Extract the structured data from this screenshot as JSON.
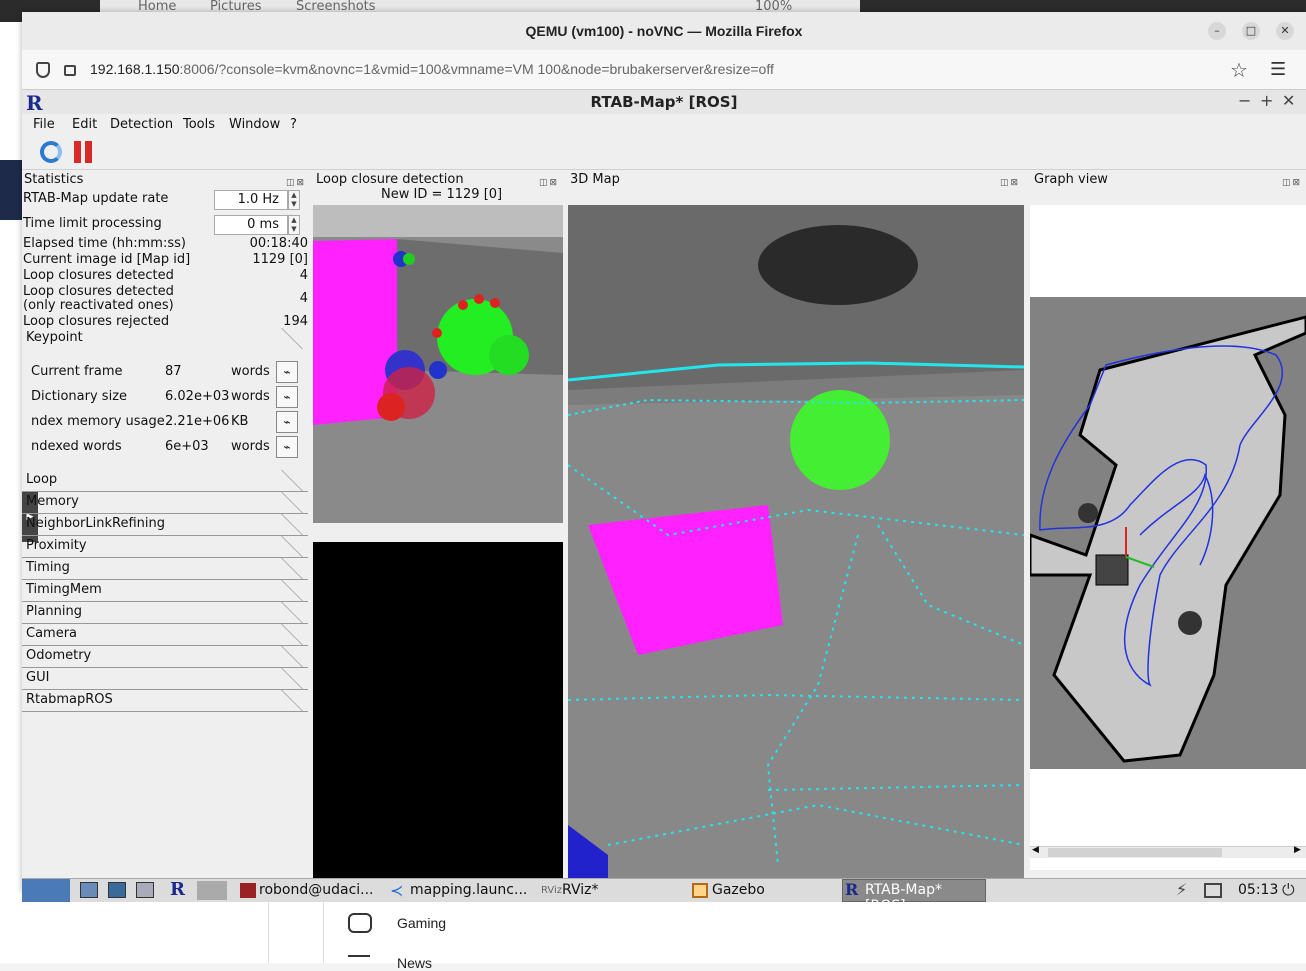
{
  "host": {
    "tabs": [
      "Home",
      "Pictures",
      "Screenshots"
    ],
    "zoom": "100%",
    "list_items": [
      "Gaming",
      "News"
    ]
  },
  "firefox": {
    "title": "QEMU (vm100) - noVNC — Mozilla Firefox",
    "url_host": "192.168.1.150",
    "url_rest": ":8006/?console=kvm&novnc=1&vmid=100&vmname=VM 100&node=brubakerserver&resize=off"
  },
  "rtab": {
    "title": "RTAB-Map* [ROS]",
    "menu": [
      "File",
      "Edit",
      "Detection",
      "Tools",
      "Window",
      "?"
    ]
  },
  "stats": {
    "title": "Statistics",
    "update_rate_label": "RTAB-Map update rate",
    "update_rate_value": "1.0 Hz",
    "time_limit_label": "Time limit processing",
    "time_limit_value": "0 ms",
    "elapsed_label": "Elapsed time (hh:mm:ss)",
    "elapsed_value": "00:18:40",
    "image_id_label": "Current image id [Map id]",
    "image_id_value": "1129 [0]",
    "loop_detected_label": "Loop closures detected",
    "loop_detected_value": "4",
    "loop_reactivated_label1": "Loop closures detected",
    "loop_reactivated_label2": "(only reactivated ones)",
    "loop_reactivated_value": "4",
    "loop_rejected_label": "Loop closures rejected",
    "loop_rejected_value": "194",
    "keypoint_section": "Keypoint",
    "keypoint_rows": [
      {
        "label": "Current frame",
        "value": "87",
        "unit": "words"
      },
      {
        "label": "Dictionary size",
        "value": "6.02e+03",
        "unit": "words"
      },
      {
        "label": "ndex memory usage",
        "value": "2.21e+06",
        "unit": "KB"
      },
      {
        "label": "ndexed words",
        "value": "6e+03",
        "unit": "words"
      }
    ],
    "sections": [
      "Loop",
      "Memory",
      "NeighborLinkRefining",
      "Proximity",
      "Timing",
      "TimingMem",
      "Planning",
      "Camera",
      "Odometry",
      "GUI",
      "RtabmapROS"
    ]
  },
  "loop_panel": {
    "title": "Loop closure detection",
    "new_id": "New ID = 1129 [0]"
  },
  "map_panel": {
    "title": "3D Map"
  },
  "graph_panel": {
    "title": "Graph view"
  },
  "taskbar": {
    "items": [
      "robond@udaci...",
      "mapping.launc...",
      "RViz*",
      "Gazebo",
      "RTAB-Map* [ROS]"
    ],
    "clock": "05:13"
  }
}
